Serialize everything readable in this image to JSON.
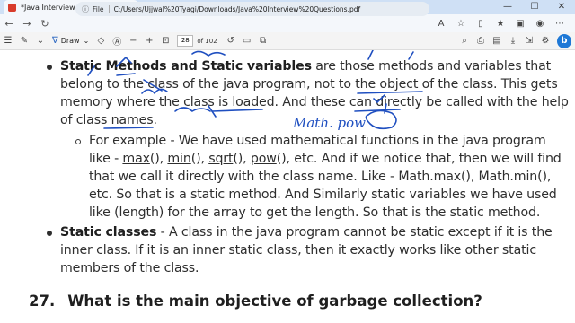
{
  "browser": {
    "tab_title": "*Java Interview Questions.pdf",
    "tab_close": "×",
    "new_tab": "+",
    "win_min": "—",
    "win_max": "☐",
    "win_close": "✕",
    "address_prefix": "File",
    "address_url": "C:/Users/Ujjwal%20Tyagi/Downloads/Java%20Interview%20Questions.pdf"
  },
  "pdf_toolbar": {
    "draw_label": "Draw",
    "page_number": "28",
    "page_total": "of 102",
    "zoom_minus": "−",
    "zoom_plus": "+"
  },
  "document": {
    "bullet1": {
      "lead": "Static Methods and Static variables",
      "line1_rest": " are those methods and variables that",
      "line2": "belong to the class of the java program, not to the object of the class. This gets",
      "line3": "memory where the class is loaded. And these can directly be called with the help",
      "line4": "of class names."
    },
    "sub_bullet": {
      "line1": "For example - We have used mathematical functions in the java program",
      "line2_a": "like - ",
      "line2_max": "max",
      "line2_b": "(), ",
      "line2_min": "min",
      "line2_c": "(), ",
      "line2_sqrt": "sqrt",
      "line2_d": "(), ",
      "line2_pow": "pow",
      "line2_e": "(), etc. And if we notice that, then we will find",
      "line3": "that we call it directly with the class name. Like - Math.max(), Math.min(),",
      "line4": "etc. So that is a static method.  And Similarly static variables we have used",
      "line5": "like (length) for the array to get the length. So that is the static method."
    },
    "bullet2": {
      "lead": "Static classes",
      "line1_rest": " - A class in the java program cannot be static except if it is the",
      "line2": "inner class. If it is an inner static class, then it exactly works like other static",
      "line3": "members of the class."
    },
    "heading": {
      "number": "27.",
      "text": "What is the main objective of garbage collection?"
    },
    "ink_annotation": "Math. pow"
  }
}
